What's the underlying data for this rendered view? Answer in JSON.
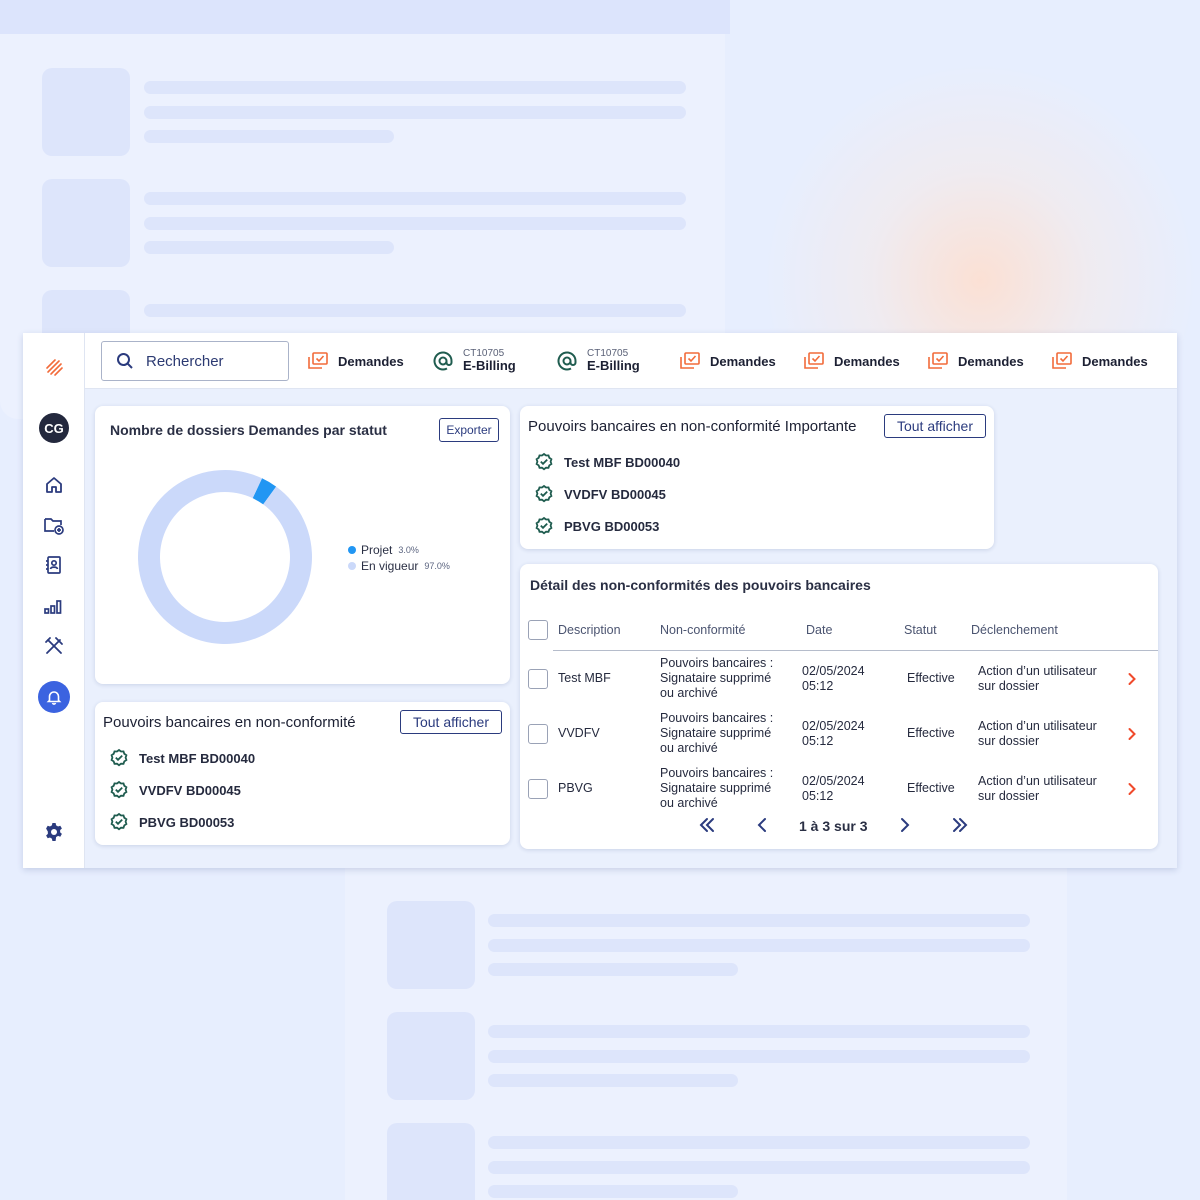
{
  "sidebar": {
    "avatar_initials": "CG",
    "icons": [
      "logo-icon",
      "home-icon",
      "folder-add-icon",
      "contacts-icon",
      "chart-icon",
      "tools-icon",
      "bell-icon",
      "settings-icon"
    ]
  },
  "topbar": {
    "search_placeholder": "Rechercher",
    "shortcuts": [
      {
        "label": "Demandes",
        "icon": "demandes-icon"
      },
      {
        "label": "E-Billing",
        "sublabel": "CT10705",
        "icon": "at-icon"
      },
      {
        "label": "E-Billing",
        "sublabel": "CT10705",
        "icon": "at-icon"
      },
      {
        "label": "Demandes",
        "icon": "demandes-icon"
      },
      {
        "label": "Demandes",
        "icon": "demandes-icon"
      },
      {
        "label": "Demandes",
        "icon": "demandes-icon"
      },
      {
        "label": "Demandes",
        "icon": "demandes-icon"
      }
    ]
  },
  "donut_card": {
    "title": "Nombre de dossiers Demandes par statut",
    "export_label": "Exporter"
  },
  "chart_data": {
    "type": "pie",
    "categories": [
      "Projet",
      "En vigueur"
    ],
    "values": [
      3.0,
      97.0
    ],
    "labels": [
      "3.0%",
      "97.0%"
    ],
    "colors": [
      "#2196f3",
      "#cbd9fa"
    ],
    "legend_position": "right"
  },
  "nonconf_card": {
    "title": "Pouvoirs bancaires en non-conformité",
    "button_label": "Tout afficher",
    "items": [
      "Test MBF BD00040",
      "VVDFV BD00045",
      "PBVG BD00053"
    ]
  },
  "nonconf_important_card": {
    "title": "Pouvoirs bancaires en non-conformité Importante",
    "button_label": "Tout afficher",
    "items": [
      "Test MBF BD00040",
      "VVDFV BD00045",
      "PBVG BD00053"
    ]
  },
  "detail_card": {
    "title": "Détail des non-conformités des pouvoirs bancaires",
    "columns": [
      "Description",
      "Non-conformité",
      "Date",
      "Statut",
      "Déclenchement"
    ],
    "rows": [
      {
        "description": "Test MBF",
        "nonconf_1": "Pouvoirs bancaires :",
        "nonconf_2": "Signataire supprimé",
        "nonconf_3": "ou archivé",
        "date": "02/05/2024",
        "time": "05:12",
        "status": "Effective",
        "trigger_1": "Action d’un utilisateur",
        "trigger_2": "sur dossier"
      },
      {
        "description": "VVDFV",
        "nonconf_1": "Pouvoirs bancaires :",
        "nonconf_2": "Signataire supprimé",
        "nonconf_3": "ou archivé",
        "date": "02/05/2024",
        "time": "05:12",
        "status": "Effective",
        "trigger_1": "Action d’un utilisateur",
        "trigger_2": "sur dossier"
      },
      {
        "description": "PBVG",
        "nonconf_1": "Pouvoirs bancaires :",
        "nonconf_2": "Signataire supprimé",
        "nonconf_3": "ou archivé",
        "date": "02/05/2024",
        "time": "05:12",
        "status": "Effective",
        "trigger_1": "Action d’un utilisateur",
        "trigger_2": "sur dossier"
      }
    ],
    "pagination": "1 à 3 sur 3"
  },
  "colors": {
    "accent_orange": "#f26b3a",
    "nav_blue": "#2b3b7e",
    "bell_blue": "#3b63e0",
    "check_green": "#1f5c4f"
  }
}
